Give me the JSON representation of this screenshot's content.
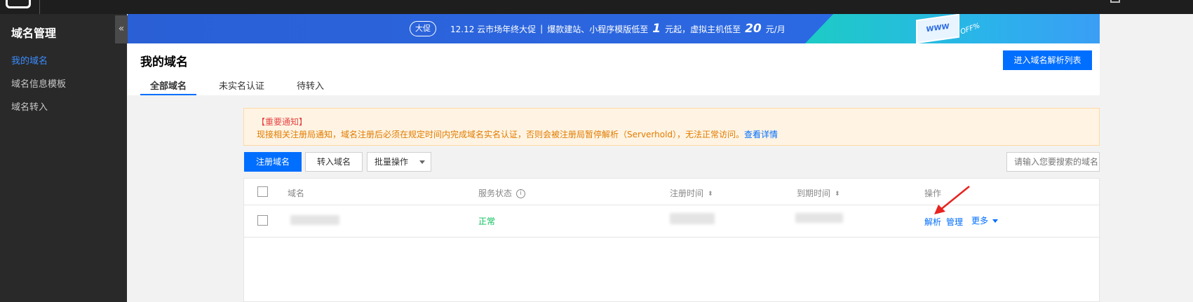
{
  "sidebar": {
    "title": "域名管理",
    "items": [
      {
        "label": "我的域名",
        "active": true
      },
      {
        "label": "域名信息模板",
        "active": false
      },
      {
        "label": "域名转入",
        "active": false
      }
    ],
    "collapse_icon": "«"
  },
  "banner": {
    "pill": "大促",
    "event": "12.12 云市场年终大促",
    "divider": "|",
    "text1": "爆款建站、小程序模版低至",
    "num1": "1",
    "text2": "元起，虚拟主机低至",
    "num2": "20",
    "text3": "元/月",
    "www": "WWW",
    "off": "OFF%"
  },
  "header": {
    "title": "我的域名",
    "action_button": "进入域名解析列表",
    "tabs": [
      {
        "label": "全部域名",
        "active": true
      },
      {
        "label": "未实名认证",
        "active": false
      },
      {
        "label": "待转入",
        "active": false
      }
    ]
  },
  "notice": {
    "title": "【重要通知】",
    "body": "现接相关注册局通知，域名注册后必须在规定时间内完成域名实名认证，否则会被注册局暂停解析（Serverhold），无法正常访问。",
    "link": "查看详情"
  },
  "toolbar": {
    "register": "注册域名",
    "transfer": "转入域名",
    "batch": "批量操作",
    "search_placeholder": "请输入您要搜索的域名"
  },
  "table": {
    "columns": {
      "domain": "域名",
      "status": "服务状态",
      "reg_time": "注册时间",
      "exp_time": "到期时间",
      "actions": "操作"
    },
    "rows": [
      {
        "status": "正常",
        "action1": "解析",
        "action2": "管理",
        "action3": "更多"
      }
    ]
  },
  "colors": {
    "primary": "#006eff",
    "success": "#0abf5b",
    "annotation_arrow": "#e8231f"
  }
}
